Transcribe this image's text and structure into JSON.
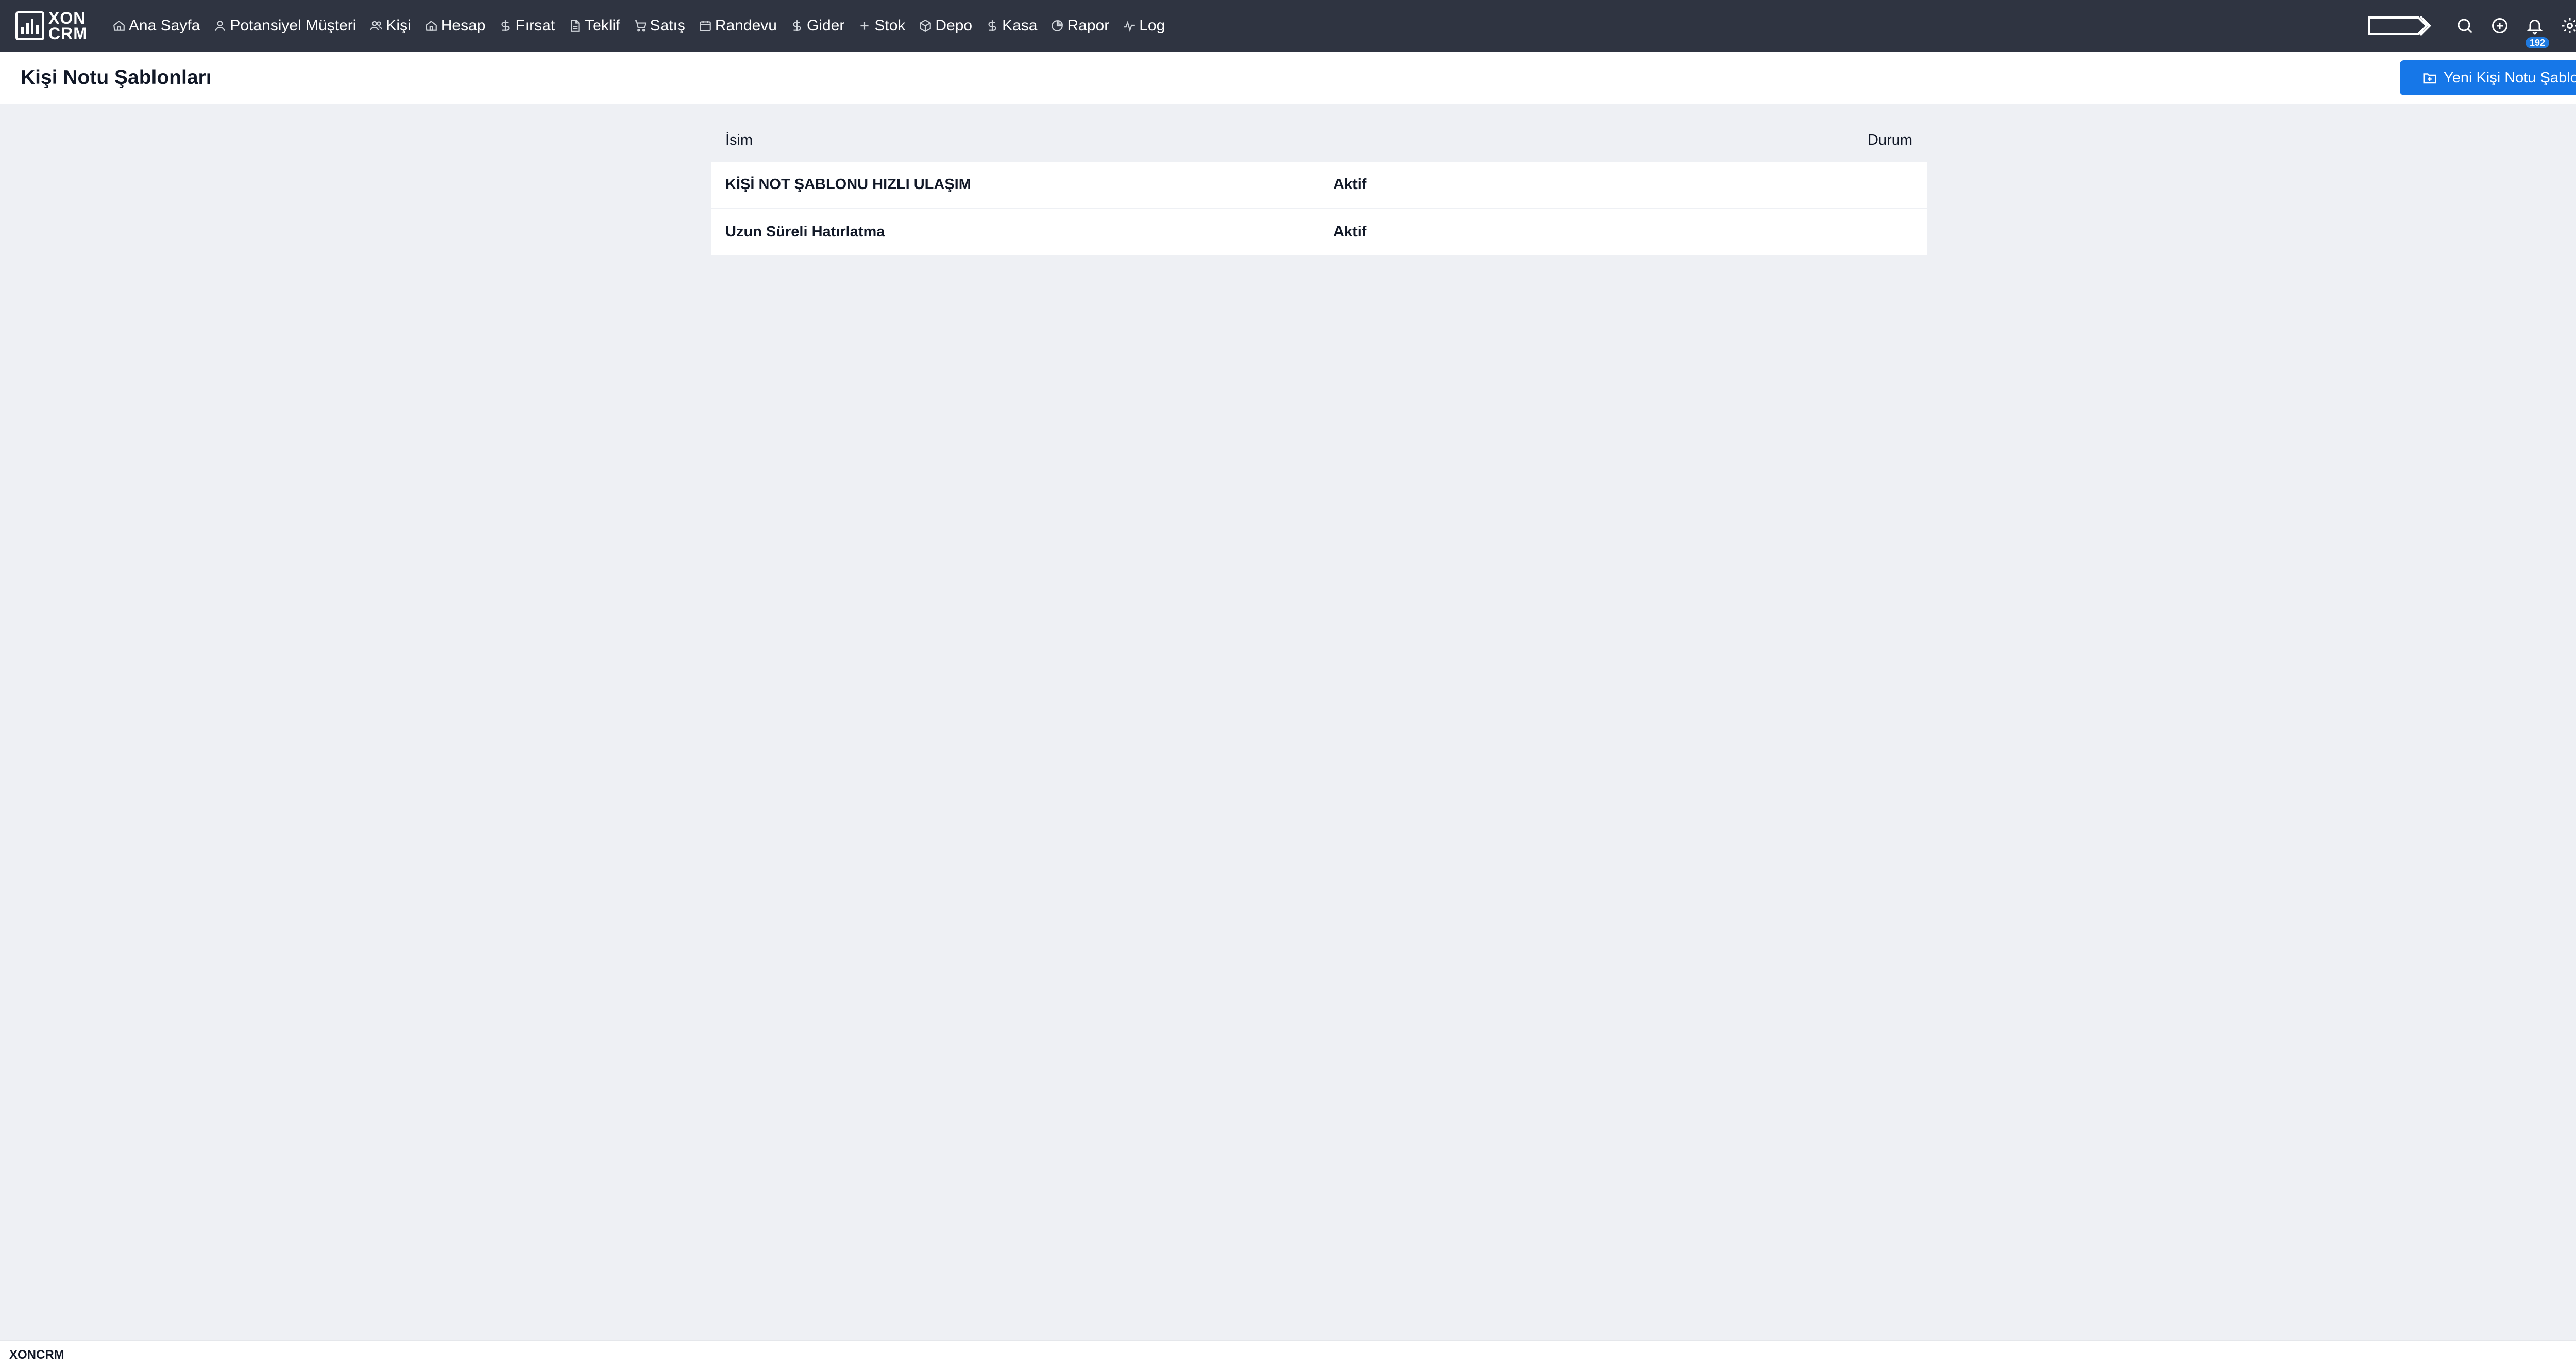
{
  "brand": {
    "line1": "XON",
    "line2": "CRM"
  },
  "nav": [
    {
      "label": "Ana Sayfa",
      "icon": "home-icon"
    },
    {
      "label": "Potansiyel Müşteri",
      "icon": "user-icon"
    },
    {
      "label": "Kişi",
      "icon": "users-icon"
    },
    {
      "label": "Hesap",
      "icon": "building-icon"
    },
    {
      "label": "Fırsat",
      "icon": "dollar-icon"
    },
    {
      "label": "Teklif",
      "icon": "document-icon"
    },
    {
      "label": "Satış",
      "icon": "cart-icon"
    },
    {
      "label": "Randevu",
      "icon": "calendar-icon"
    },
    {
      "label": "Gider",
      "icon": "dollar-icon"
    },
    {
      "label": "Stok",
      "icon": "plus-icon"
    },
    {
      "label": "Depo",
      "icon": "box-icon"
    },
    {
      "label": "Kasa",
      "icon": "dollar-icon"
    },
    {
      "label": "Rapor",
      "icon": "pie-chart-icon"
    },
    {
      "label": "Log",
      "icon": "activity-icon"
    }
  ],
  "header_right": {
    "notification_count": "192"
  },
  "page": {
    "title": "Kişi Notu Şablonları",
    "new_button_label": "Yeni Kişi Notu Şablonu"
  },
  "table": {
    "columns": {
      "name": "İsim",
      "status": "Durum"
    },
    "rows": [
      {
        "name": "KİŞİ NOT ŞABLONU HIZLI ULAŞIM",
        "status": "Aktif"
      },
      {
        "name": "Uzun Süreli Hatırlatma",
        "status": "Aktif"
      }
    ]
  },
  "footer": {
    "text": "XONCRM"
  },
  "colors": {
    "navbar": "#2f3441",
    "accent": "#1677e8",
    "background": "#eef0f4"
  }
}
